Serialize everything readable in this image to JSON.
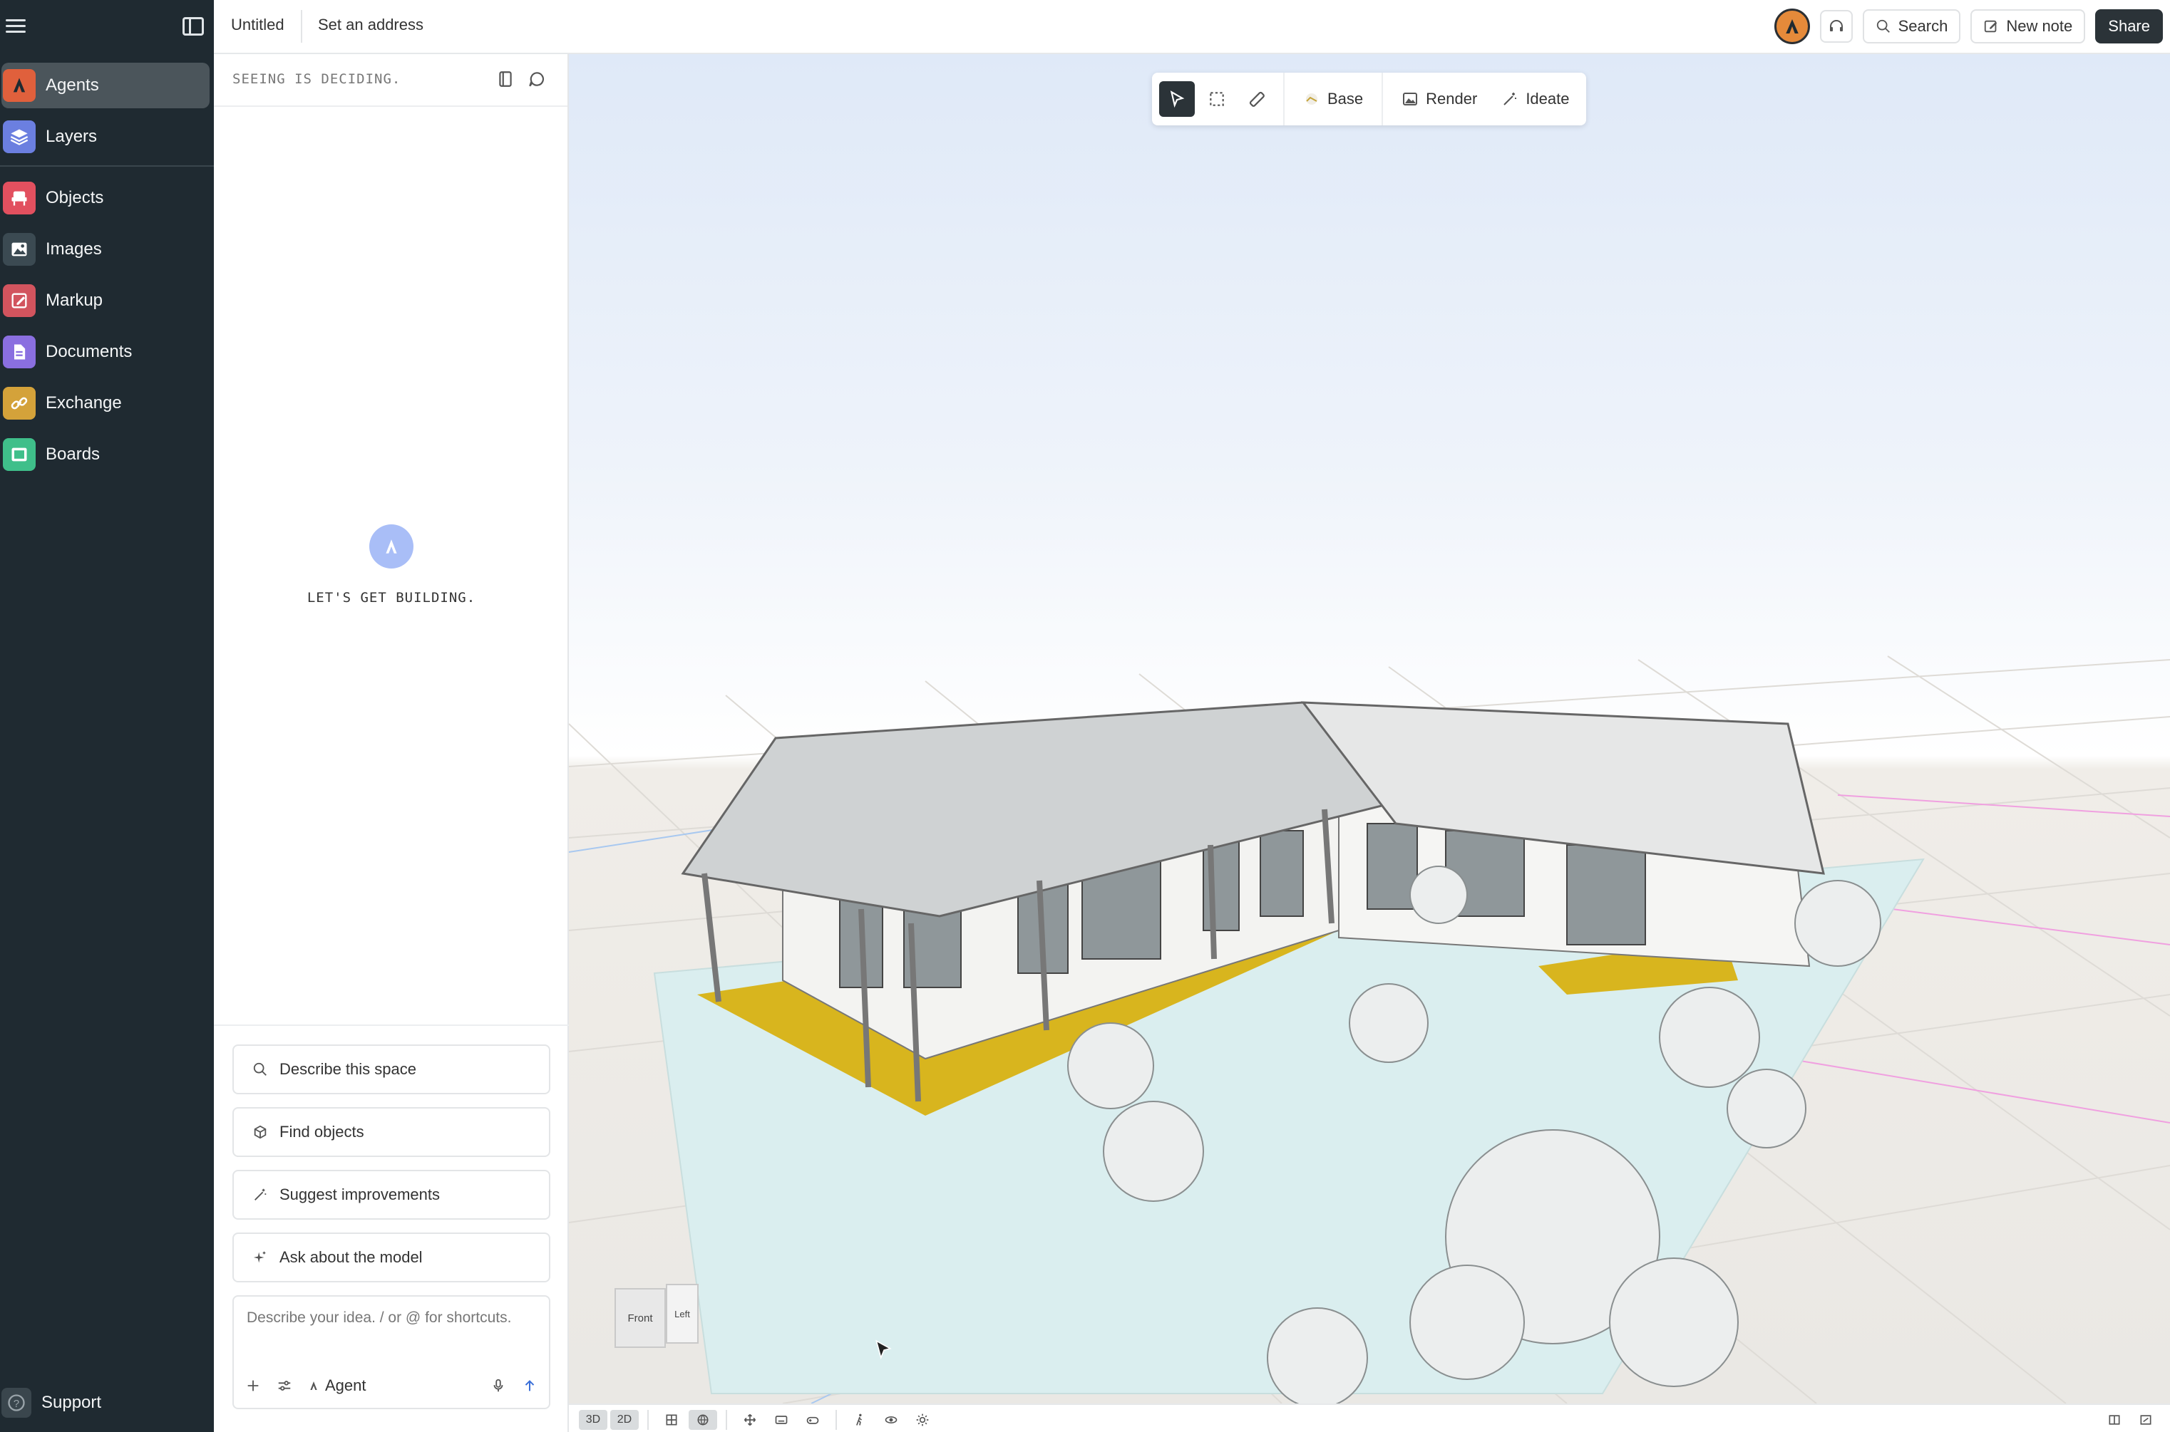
{
  "app": {
    "document_title": "Untitled",
    "address_placeholder": "Set an address"
  },
  "sidebar": {
    "items": [
      {
        "id": "agents",
        "label": "Agents",
        "icon": "agents-icon",
        "color": "#e0603c",
        "active": true
      },
      {
        "id": "layers",
        "label": "Layers",
        "icon": "layers-icon",
        "color": "#6b7fe0",
        "active": false
      },
      {
        "id": "objects",
        "label": "Objects",
        "icon": "chair-icon",
        "color": "#e2505f",
        "active": false
      },
      {
        "id": "images",
        "label": "Images",
        "icon": "image-icon",
        "color": "#3b4a52",
        "active": false
      },
      {
        "id": "markup",
        "label": "Markup",
        "icon": "pencil-icon",
        "color": "#d2545e",
        "active": false
      },
      {
        "id": "documents",
        "label": "Documents",
        "icon": "document-icon",
        "color": "#8a6fe0",
        "active": false
      },
      {
        "id": "exchange",
        "label": "Exchange",
        "icon": "link-icon",
        "color": "#d4a23a",
        "active": false
      },
      {
        "id": "boards",
        "label": "Boards",
        "icon": "board-icon",
        "color": "#3fbf8a",
        "active": false
      }
    ],
    "support_label": "Support"
  },
  "topbar": {
    "search_label": "Search",
    "new_note_label": "New note",
    "share_label": "Share"
  },
  "agent_panel": {
    "status_text": "SEEING IS DECIDING.",
    "empty_text": "LET'S GET BUILDING.",
    "suggestions": [
      {
        "label": "Describe this space",
        "icon": "search-icon"
      },
      {
        "label": "Find objects",
        "icon": "cube-icon"
      },
      {
        "label": "Suggest improvements",
        "icon": "magic-wand-icon"
      },
      {
        "label": "Ask about the model",
        "icon": "sparkle-icon"
      }
    ],
    "composer_placeholder": "Describe your idea. / or @ for shortcuts.",
    "mode_label": "Agent"
  },
  "viewport": {
    "toolbar": {
      "base_label": "Base",
      "render_label": "Render",
      "ideate_label": "Ideate"
    },
    "view_cube": {
      "front": "Front",
      "left": "Left"
    },
    "bottom_bar": {
      "mode_3d": "3D",
      "mode_2d": "2D"
    }
  },
  "colors": {
    "sidebar_bg": "#1f2a31",
    "accent_dark": "#2b3338",
    "deck_yellow": "#d8b51e",
    "lawn": "#daeeef"
  }
}
